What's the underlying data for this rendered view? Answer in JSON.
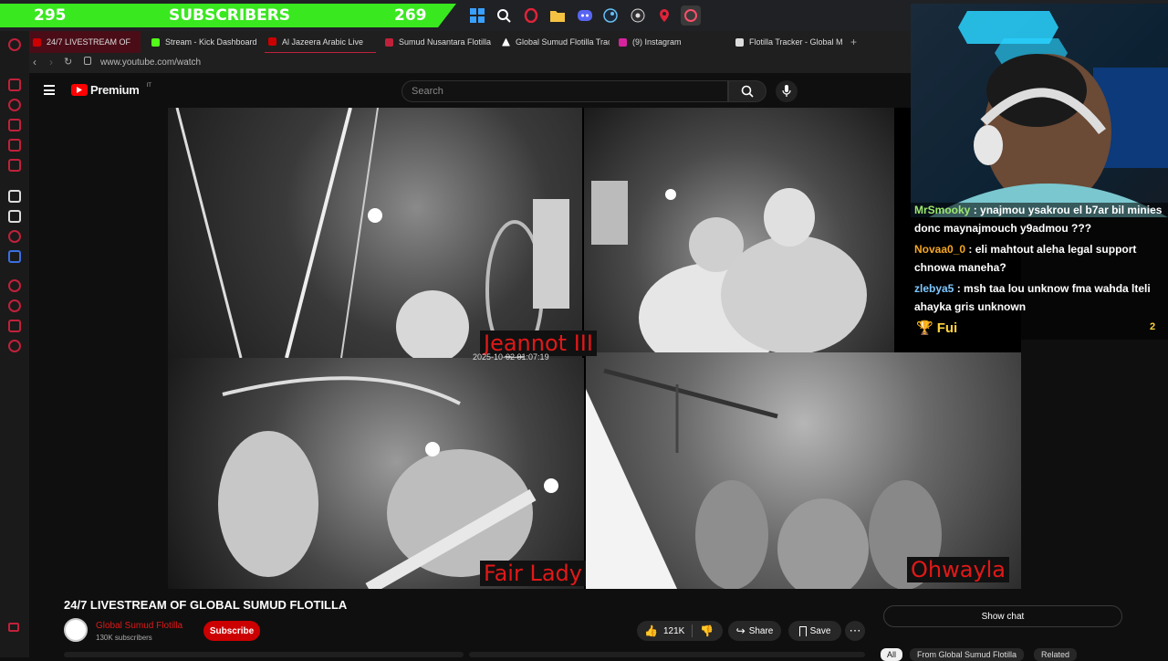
{
  "overlay": {
    "subs_left": "295",
    "subs_label": "SUBSCRIBERS",
    "subs_right": "269"
  },
  "taskbar": {
    "icons": [
      "windows-icon",
      "search-icon",
      "opera-icon",
      "folder-icon",
      "discord-icon",
      "steam-icon",
      "obs-icon",
      "maps-icon",
      "opera-gx-icon"
    ]
  },
  "tabs": [
    {
      "label": "24/7 LIVESTREAM OF",
      "fav": "#cc0000",
      "active": true
    },
    {
      "label": "Stream - Kick Dashboard",
      "fav": "#53fc18"
    },
    {
      "label": "Al Jazeera Arabic Live",
      "fav": "#cc0000"
    },
    {
      "label": "Sumud Nusantara Flotilla",
      "fav": "#c0213a"
    },
    {
      "label": "Global Sumud Flotilla Track",
      "fav": "#ffffff"
    },
    {
      "label": "(9) Instagram",
      "fav": "#d6249f"
    },
    {
      "label": "Flotilla Tracker - Global M",
      "fav": "#dddddd"
    }
  ],
  "browser": {
    "url": "www.youtube.com/watch"
  },
  "youtube": {
    "logo_text": "Premium",
    "logo_suffix": "IT",
    "search_placeholder": "Search"
  },
  "video": {
    "cameras": [
      {
        "label": ""
      },
      {
        "label": "Jeannot III",
        "timestamp": "2025-10-02 01:07:19"
      },
      {
        "label": "Fair Lady"
      },
      {
        "label": "Ohwayla"
      }
    ]
  },
  "chat": {
    "messages": [
      {
        "user": "MrSmooky",
        "color": "#9ee86d",
        "text": "ynajmou ysakrou el b7ar bil minies donc maynajmouch y9admou ???"
      },
      {
        "user": "Novaa0_0",
        "color": "#f5a623",
        "text": "eli mahtout aleha legal support chnowa maneha?"
      },
      {
        "user": "zlebya5",
        "color": "#7ec8ff",
        "text": "msh taa lou unknow fma wahda lteli ahayka gris unknown"
      }
    ],
    "leader_name": "Fui",
    "leader_count": "2"
  },
  "below": {
    "title": "24/7 LIVESTREAM OF GLOBAL SUMUD FLOTILLA",
    "channel_name": "Global Sumud Flotilla",
    "channel_subs": "130K subscribers",
    "subscribe_label": "Subscribe",
    "likes": "121K",
    "share_label": "Share",
    "save_label": "Save",
    "show_chat_label": "Show chat",
    "chips": [
      "All",
      "From Global Sumud Flotilla",
      "Related"
    ]
  }
}
